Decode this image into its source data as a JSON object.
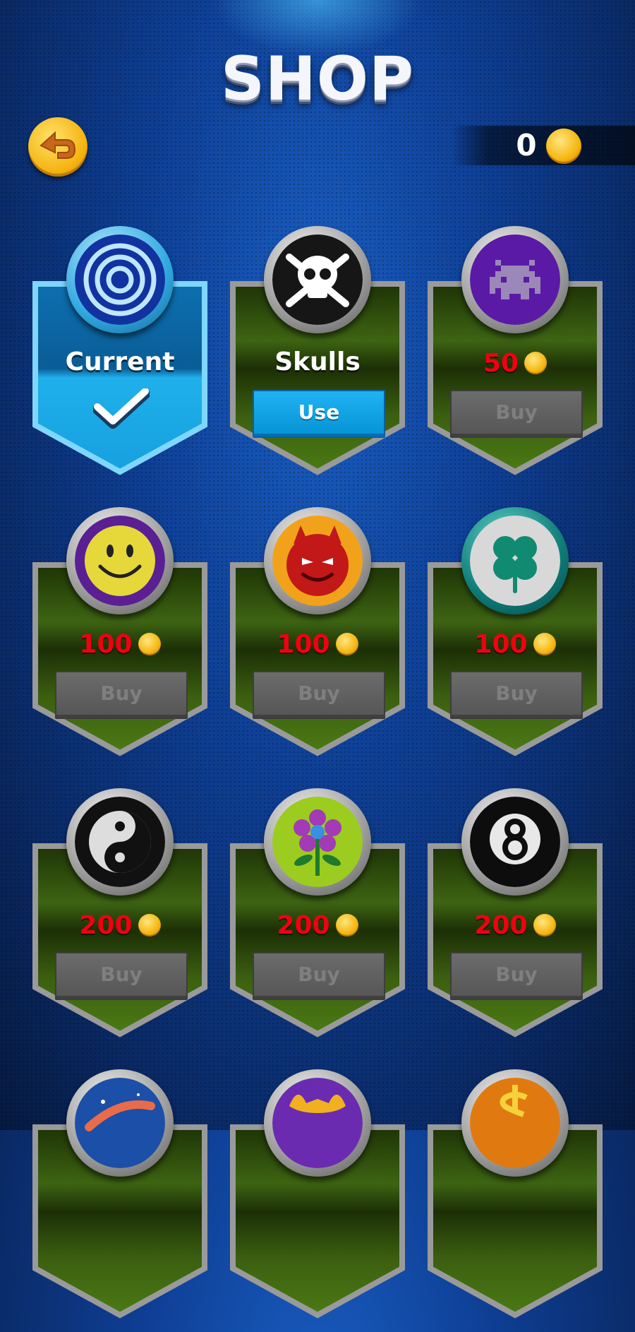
{
  "header": {
    "title": "SHOP"
  },
  "wallet": {
    "coins": "0",
    "coin_icon": "gold-coin-icon"
  },
  "back": {
    "icon": "back-arrow-icon"
  },
  "colors": {
    "current": "#1fa8e8",
    "owned_button": "#12a3e8",
    "locked_button": "#5f5f5f",
    "price": "#f00010",
    "card_green": "#2d4a0c"
  },
  "items": [
    {
      "id": "spiral",
      "icon": "blue-spiral-icon",
      "state": "current",
      "label": "Current"
    },
    {
      "id": "skulls",
      "icon": "skull-crossbones-icon",
      "state": "owned",
      "label": "Skulls",
      "button": "Use"
    },
    {
      "id": "invader",
      "icon": "space-invader-icon",
      "state": "locked",
      "price": "50",
      "button": "Buy"
    },
    {
      "id": "smiley",
      "icon": "smiley-face-icon",
      "state": "locked",
      "price": "100",
      "button": "Buy"
    },
    {
      "id": "devil",
      "icon": "devil-face-icon",
      "state": "locked",
      "price": "100",
      "button": "Buy"
    },
    {
      "id": "clover",
      "icon": "four-leaf-clover-icon",
      "state": "locked",
      "price": "100",
      "button": "Buy"
    },
    {
      "id": "yinyang",
      "icon": "yin-yang-icon",
      "state": "locked",
      "price": "200",
      "button": "Buy"
    },
    {
      "id": "flower",
      "icon": "flower-icon",
      "state": "locked",
      "price": "200",
      "button": "Buy"
    },
    {
      "id": "eightball",
      "icon": "eight-ball-icon",
      "state": "locked",
      "price": "200",
      "button": "Buy"
    },
    {
      "id": "space",
      "icon": "planet-icon",
      "state": "locked"
    },
    {
      "id": "demon",
      "icon": "purple-demon-icon",
      "state": "locked"
    },
    {
      "id": "dollar",
      "icon": "dollar-sign-icon",
      "state": "locked"
    }
  ]
}
